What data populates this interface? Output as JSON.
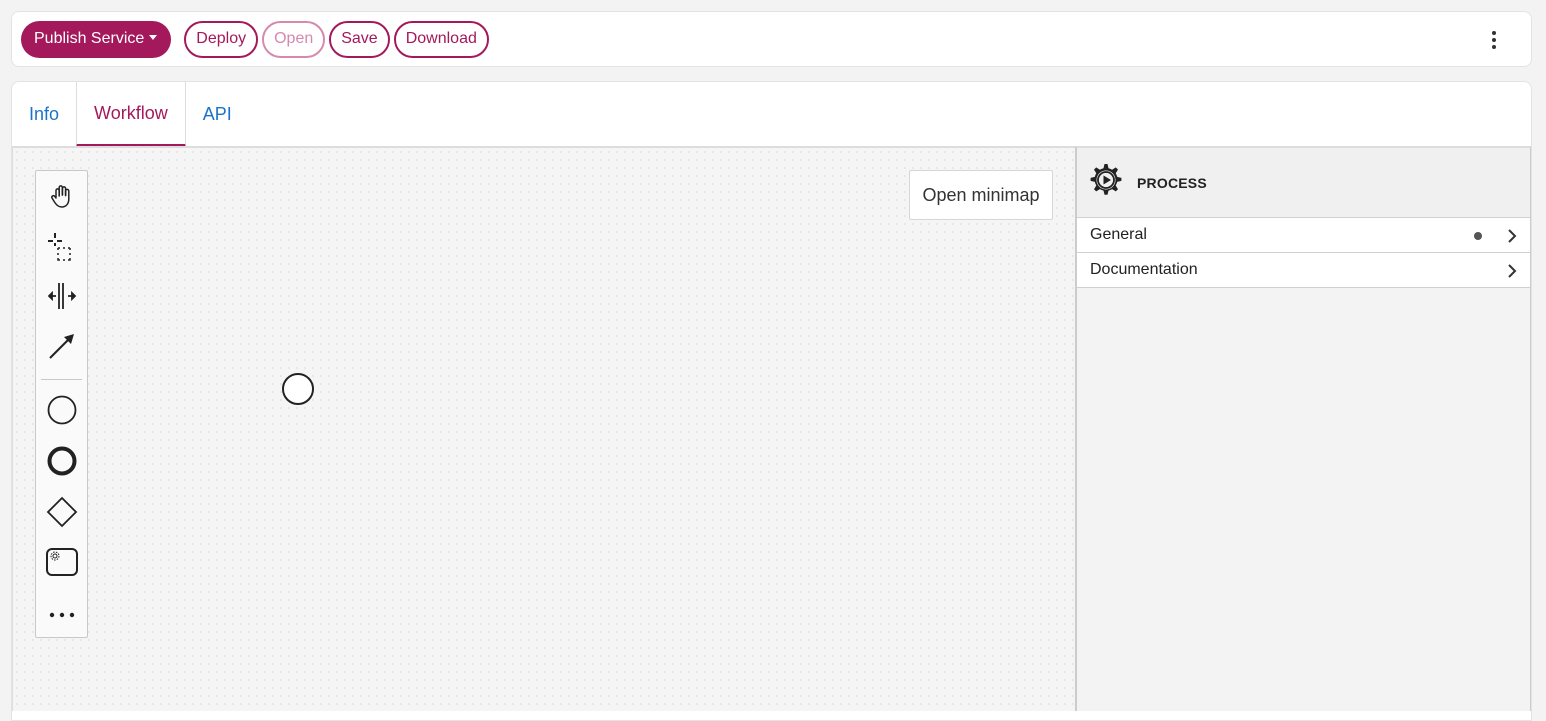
{
  "toolbar": {
    "publish_label": "Publish Service",
    "deploy_label": "Deploy",
    "open_label": "Open",
    "save_label": "Save",
    "download_label": "Download",
    "more_icon": "kebab-vertical-icon"
  },
  "tabs": [
    {
      "label": "Info",
      "active": false
    },
    {
      "label": "Workflow",
      "active": true
    },
    {
      "label": "API",
      "active": false
    }
  ],
  "palette": {
    "tools": [
      "hand-tool-icon",
      "lasso-tool-icon",
      "space-tool-icon",
      "connect-tool-icon",
      "start-event-icon",
      "end-event-icon",
      "gateway-icon",
      "service-task-icon",
      "more-tools-icon"
    ]
  },
  "canvas": {
    "minimap_label": "Open minimap"
  },
  "properties": {
    "header_icon": "process-gear-icon",
    "title": "PROCESS",
    "groups": [
      {
        "label": "General",
        "has_indicator": true
      },
      {
        "label": "Documentation",
        "has_indicator": false
      }
    ]
  },
  "colors": {
    "accent": "#a3195b",
    "link": "#1a73c8"
  }
}
